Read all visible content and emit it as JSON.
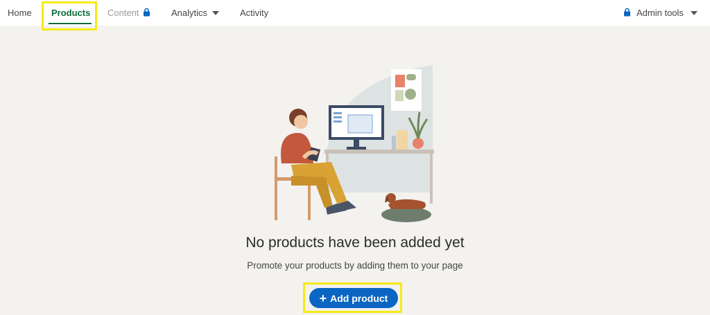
{
  "nav": {
    "home": "Home",
    "products": "Products",
    "content": "Content",
    "analytics": "Analytics",
    "activity": "Activity",
    "admin_tools": "Admin tools"
  },
  "empty_state": {
    "title": "No products have been added yet",
    "subtitle": "Promote your products by adding them to your page",
    "add_button": "Add product"
  },
  "icons": {
    "lock": "lock-icon",
    "caret": "chevron-down-icon",
    "plus": "plus-icon"
  },
  "colors": {
    "accent_green": "#0b6b3a",
    "primary_blue": "#0a66c2",
    "highlight_yellow": "#f5ea14",
    "background": "#f3f2ef"
  }
}
